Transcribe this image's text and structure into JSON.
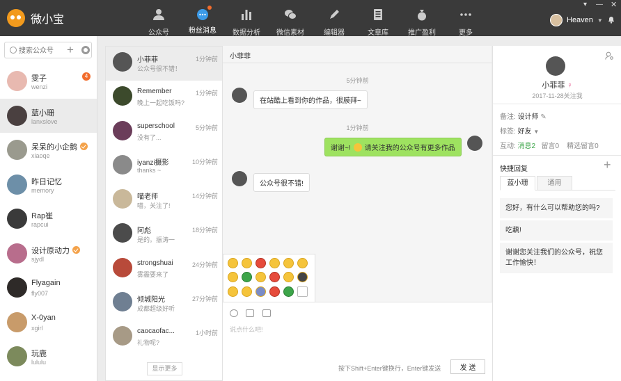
{
  "app": {
    "name": "微小宝"
  },
  "nav": [
    {
      "label": "公众号",
      "icon": "user-icon"
    },
    {
      "label": "粉丝消息",
      "icon": "chat-bubble-icon"
    },
    {
      "label": "数据分析",
      "icon": "bar-chart-icon"
    },
    {
      "label": "微信素材",
      "icon": "wechat-icon"
    },
    {
      "label": "编辑器",
      "icon": "pen-icon"
    },
    {
      "label": "文章库",
      "icon": "document-icon"
    },
    {
      "label": "推广盈利",
      "icon": "money-bag-icon"
    },
    {
      "label": "更多",
      "icon": "more-icon"
    }
  ],
  "user": {
    "name": "Heaven"
  },
  "search": {
    "placeholder": "搜索公众号"
  },
  "accounts": [
    {
      "name": "雯子",
      "id": "wenzi",
      "badge": "4",
      "verified": false
    },
    {
      "name": "蓝小珊",
      "id": "lanxslove",
      "verified": false
    },
    {
      "name": "呆呆的小企鹅",
      "id": "xiaoqe",
      "verified": true
    },
    {
      "name": "昨日记忆",
      "id": "memory",
      "verified": false
    },
    {
      "name": "Rap崔",
      "id": "rapcui",
      "verified": false
    },
    {
      "name": "设计原动力",
      "id": "sjydl",
      "verified": true
    },
    {
      "name": "Flyagain",
      "id": "fly007",
      "verified": false
    },
    {
      "name": "X-0yan",
      "id": "xgirl",
      "verified": false
    },
    {
      "name": "玩鹿",
      "id": "lululu",
      "verified": false
    }
  ],
  "conversations": [
    {
      "name": "小菲菲",
      "time": "1分钟前",
      "msg": "公众号很不错！"
    },
    {
      "name": "Remember",
      "time": "1分钟前",
      "msg": "晚上一起吃饭吗?"
    },
    {
      "name": "superschool",
      "time": "5分钟前",
      "msg": "没有了..."
    },
    {
      "name": "iyanzi摄影",
      "time": "10分钟前",
      "msg": "thanks ~"
    },
    {
      "name": "喵老师",
      "time": "14分钟前",
      "msg": "喵，关注了!"
    },
    {
      "name": "阿彪",
      "time": "18分钟前",
      "msg": "是的。振涛一"
    },
    {
      "name": "strongshuai",
      "time": "24分钟前",
      "msg": "雾霾要来了"
    },
    {
      "name": "倾城阳光",
      "time": "27分钟前",
      "msg": "成都超级好听"
    },
    {
      "name": "caocaofac...",
      "time": "1小时前",
      "msg": "礼物呢?"
    }
  ],
  "show_more": "显示更多",
  "chat": {
    "title": "小菲菲",
    "messages": [
      {
        "time": "5分钟前",
        "from": "them",
        "text": "在站酷上看到你的作品，很膜拜~"
      },
      {
        "time": "1分钟前",
        "from": "me",
        "text_before": "谢谢~!",
        "text_after": "请关注我的公众号有更多作品"
      },
      {
        "from": "them",
        "text": "公众号很不错!"
      }
    ],
    "input_placeholder": "说点什么吧!",
    "hint": "按下Shift+Enter键换行，Enter键发送",
    "send": "发 送"
  },
  "profile": {
    "name": "小菲菲",
    "follow_date": "2017-11-28关注我",
    "note_label": "备注:",
    "note_value": "设计师",
    "tag_label": "标签:",
    "tag_value": "好友",
    "interact_label": "互动:",
    "interact_msg": "消息2",
    "interact_comment": "留言0",
    "interact_selected": "精选留言0"
  },
  "quick_reply": {
    "title": "快捷回复",
    "tabs": [
      "蓝小珊",
      "通用"
    ],
    "items": [
      "您好，有什么可以帮助您的吗?",
      "吃藕!",
      "谢谢您关注我们的公众号，祝您工作愉快！"
    ]
  },
  "colors": {
    "topbar": "#3a3a3a",
    "accent": "#f26c2c",
    "bubble_me": "#9ee260",
    "link_green": "#3da54a"
  }
}
